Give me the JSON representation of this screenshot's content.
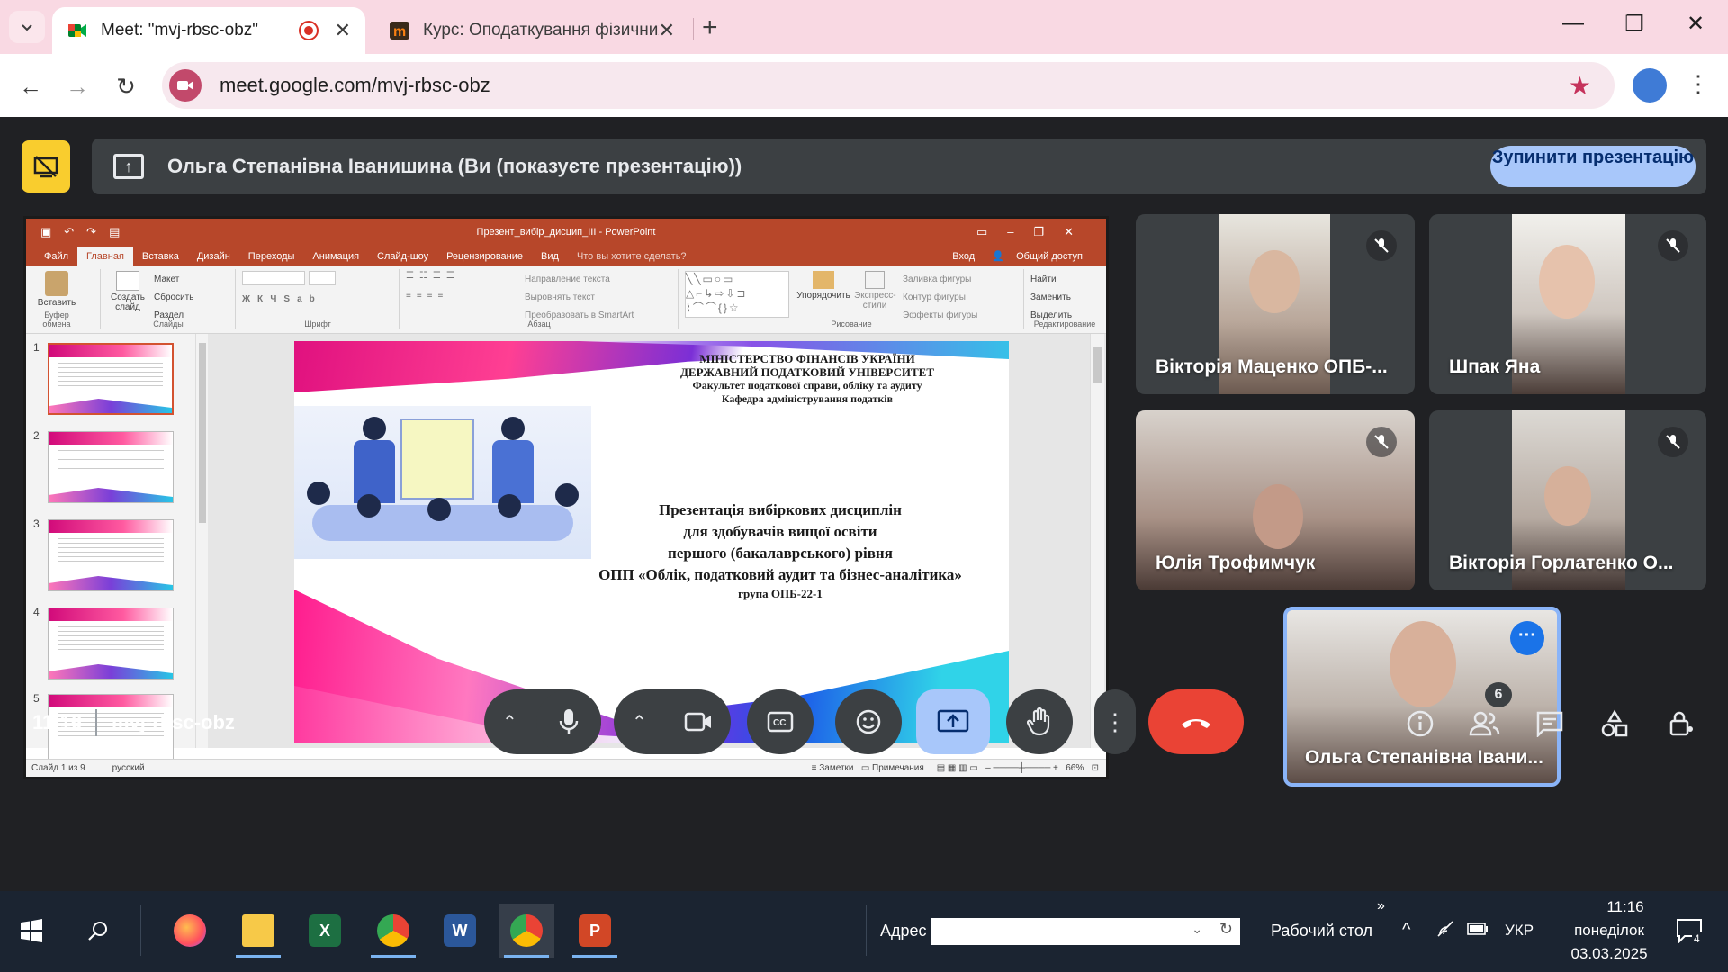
{
  "browser": {
    "tabs": [
      {
        "title": "Meet: \"mvj-rbsc-obz\"",
        "active": true
      },
      {
        "title": "Курс: Оподаткування фізичних",
        "active": false
      }
    ],
    "url": "meet.google.com/mvj-rbsc-obz"
  },
  "meet": {
    "presenting_banner": "Ольга Степанівна Іванишина (Ви (показуєте презентацію))",
    "stop_button": "Зупинити презентацію",
    "time": "11:16",
    "meeting_code": "mvj-rbsc-obz",
    "participant_count": "6",
    "participants": [
      {
        "name": "Вікторія Маценко ОПБ-...",
        "muted": true
      },
      {
        "name": "Шпак Яна",
        "muted": true
      },
      {
        "name": "Юлія Трофимчук",
        "muted": true
      },
      {
        "name": "Вікторія Горлатенко О...",
        "muted": true
      },
      {
        "name": "Ольга Степанівна Івани...",
        "self": true
      }
    ]
  },
  "powerpoint": {
    "title": "Презент_вибір_дисцип_III - PowerPoint",
    "tabs": [
      "Файл",
      "Главная",
      "Вставка",
      "Дизайн",
      "Переходы",
      "Анимация",
      "Слайд-шоу",
      "Рецензирование",
      "Вид",
      "Что вы хотите сделать?"
    ],
    "sign_in": "Вход",
    "share": "Общий доступ",
    "ribbon_groups": [
      "Буфер обмена",
      "Слайды",
      "Шрифт",
      "Абзац",
      "Рисование",
      "Редактирование"
    ],
    "ribbon": {
      "paste": "Вставить",
      "new_slide": "Создать слайд",
      "layout": "Макет",
      "reset": "Сбросить",
      "section": "Раздел",
      "text_direction": "Направление текста",
      "align_text": "Выровнять текст",
      "smartart": "Преобразовать в SmartArt",
      "arrange": "Упорядочить",
      "quick_styles": "Экспресс-стили",
      "shape_fill": "Заливка фигуры",
      "shape_outline": "Контур фигуры",
      "shape_effects": "Эффекты фигуры",
      "find": "Найти",
      "replace": "Заменить",
      "select": "Выделить"
    },
    "slide_numbers": [
      "1",
      "2",
      "3",
      "4",
      "5"
    ],
    "slide": {
      "header_lines": [
        "МІНІСТЕРСТВО ФІНАНСІВ УКРАЇНИ",
        "ДЕРЖАВНИЙ ПОДАТКОВИЙ УНІВЕРСИТЕТ",
        "Факультет податкової справи, обліку та аудиту",
        "Кафедра адміністрування податків"
      ],
      "main_lines": [
        "Презентація вибіркових дисциплін",
        "для здобувачів вищої освіти",
        "першого (бакалаврського) рівня",
        "ОПП «Облік, податковий аудит та бізнес-аналітика»"
      ],
      "group": "група ОПБ-22-1"
    },
    "status": {
      "slide_info": "Слайд 1 из 9",
      "language": "русский",
      "notes": "Заметки",
      "comments": "Примечания",
      "zoom": "66%"
    }
  },
  "taskbar": {
    "address_label": "Адрес",
    "desktop_label": "Рабочий стол",
    "language": "УКР",
    "time": "11:16",
    "day": "понеділок",
    "date": "03.03.2025",
    "notifications": "4"
  }
}
